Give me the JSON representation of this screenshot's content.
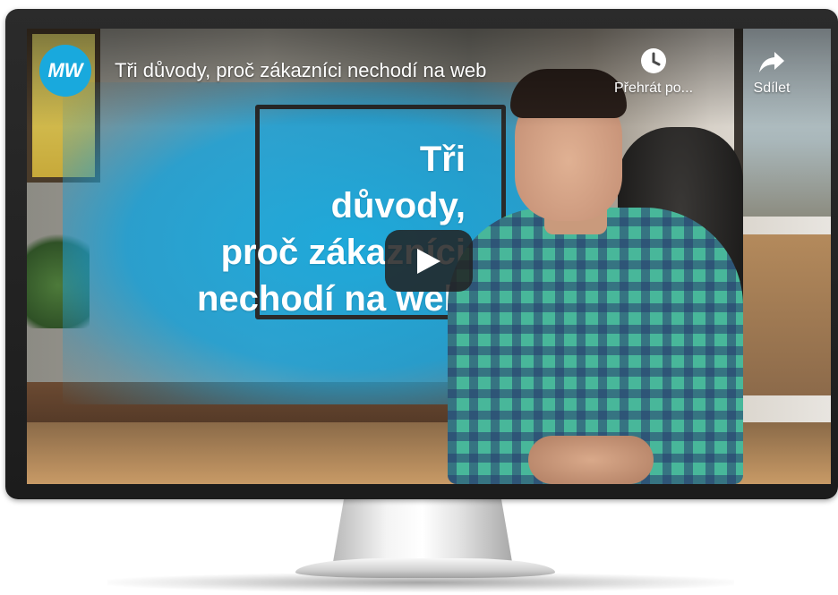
{
  "video": {
    "channel_logo_text": "MW",
    "title": "Tři důvody, proč zákazníci nechodí na web",
    "actions": [
      {
        "label": "Přehrát po...",
        "icon": "clock-icon"
      },
      {
        "label": "Sdílet",
        "icon": "share-arrow-icon"
      }
    ],
    "thumbnail_text": [
      "Tři",
      "důvody,",
      "proč zákazníci",
      "nechodí na web"
    ],
    "play_icon": "play-icon"
  },
  "colors": {
    "accent": "#19a9dd",
    "play_button_bg": "#212121",
    "bezel": "#222222"
  }
}
